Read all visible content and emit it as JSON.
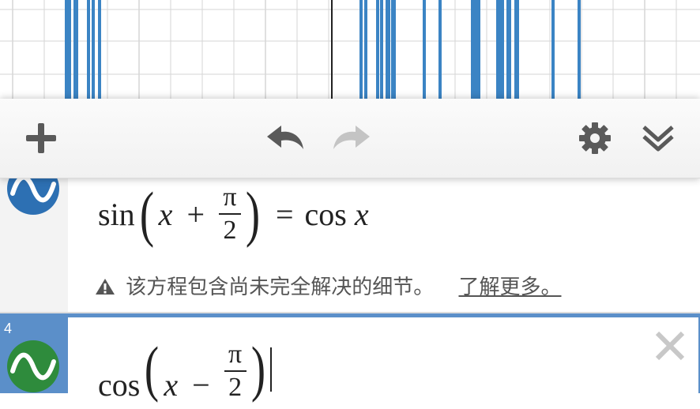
{
  "toolbar": {
    "add_icon": "plus-icon",
    "undo_icon": "undo-arrow-icon",
    "redo_icon": "redo-arrow-icon",
    "settings_icon": "gear-icon",
    "collapse_icon": "double-chevron-down-icon"
  },
  "expressions": [
    {
      "index": "",
      "lhs_fn": "sin",
      "var": "x",
      "op": "+",
      "frac_num": "π",
      "frac_den": "2",
      "eq": "=",
      "rhs_fn": "cos",
      "rhs_var": "x",
      "warning": "该方程包含尚未完全解决的细节。",
      "learn_more": "了解更多。",
      "state": "normal"
    },
    {
      "index": "4",
      "lhs_fn": "cos",
      "var": "x",
      "op": "−",
      "frac_num": "π",
      "frac_den": "2",
      "state": "selected"
    }
  ],
  "colors": {
    "accent": "#2d70b3",
    "selected_gutter": "#5b8fc9",
    "line_color": "#3b84c4",
    "grid_color": "#d6d6d6",
    "icon_gray": "#5a5a5a",
    "icon_disabled": "#c4c4c4",
    "logo_green": "#2e8b3c"
  }
}
